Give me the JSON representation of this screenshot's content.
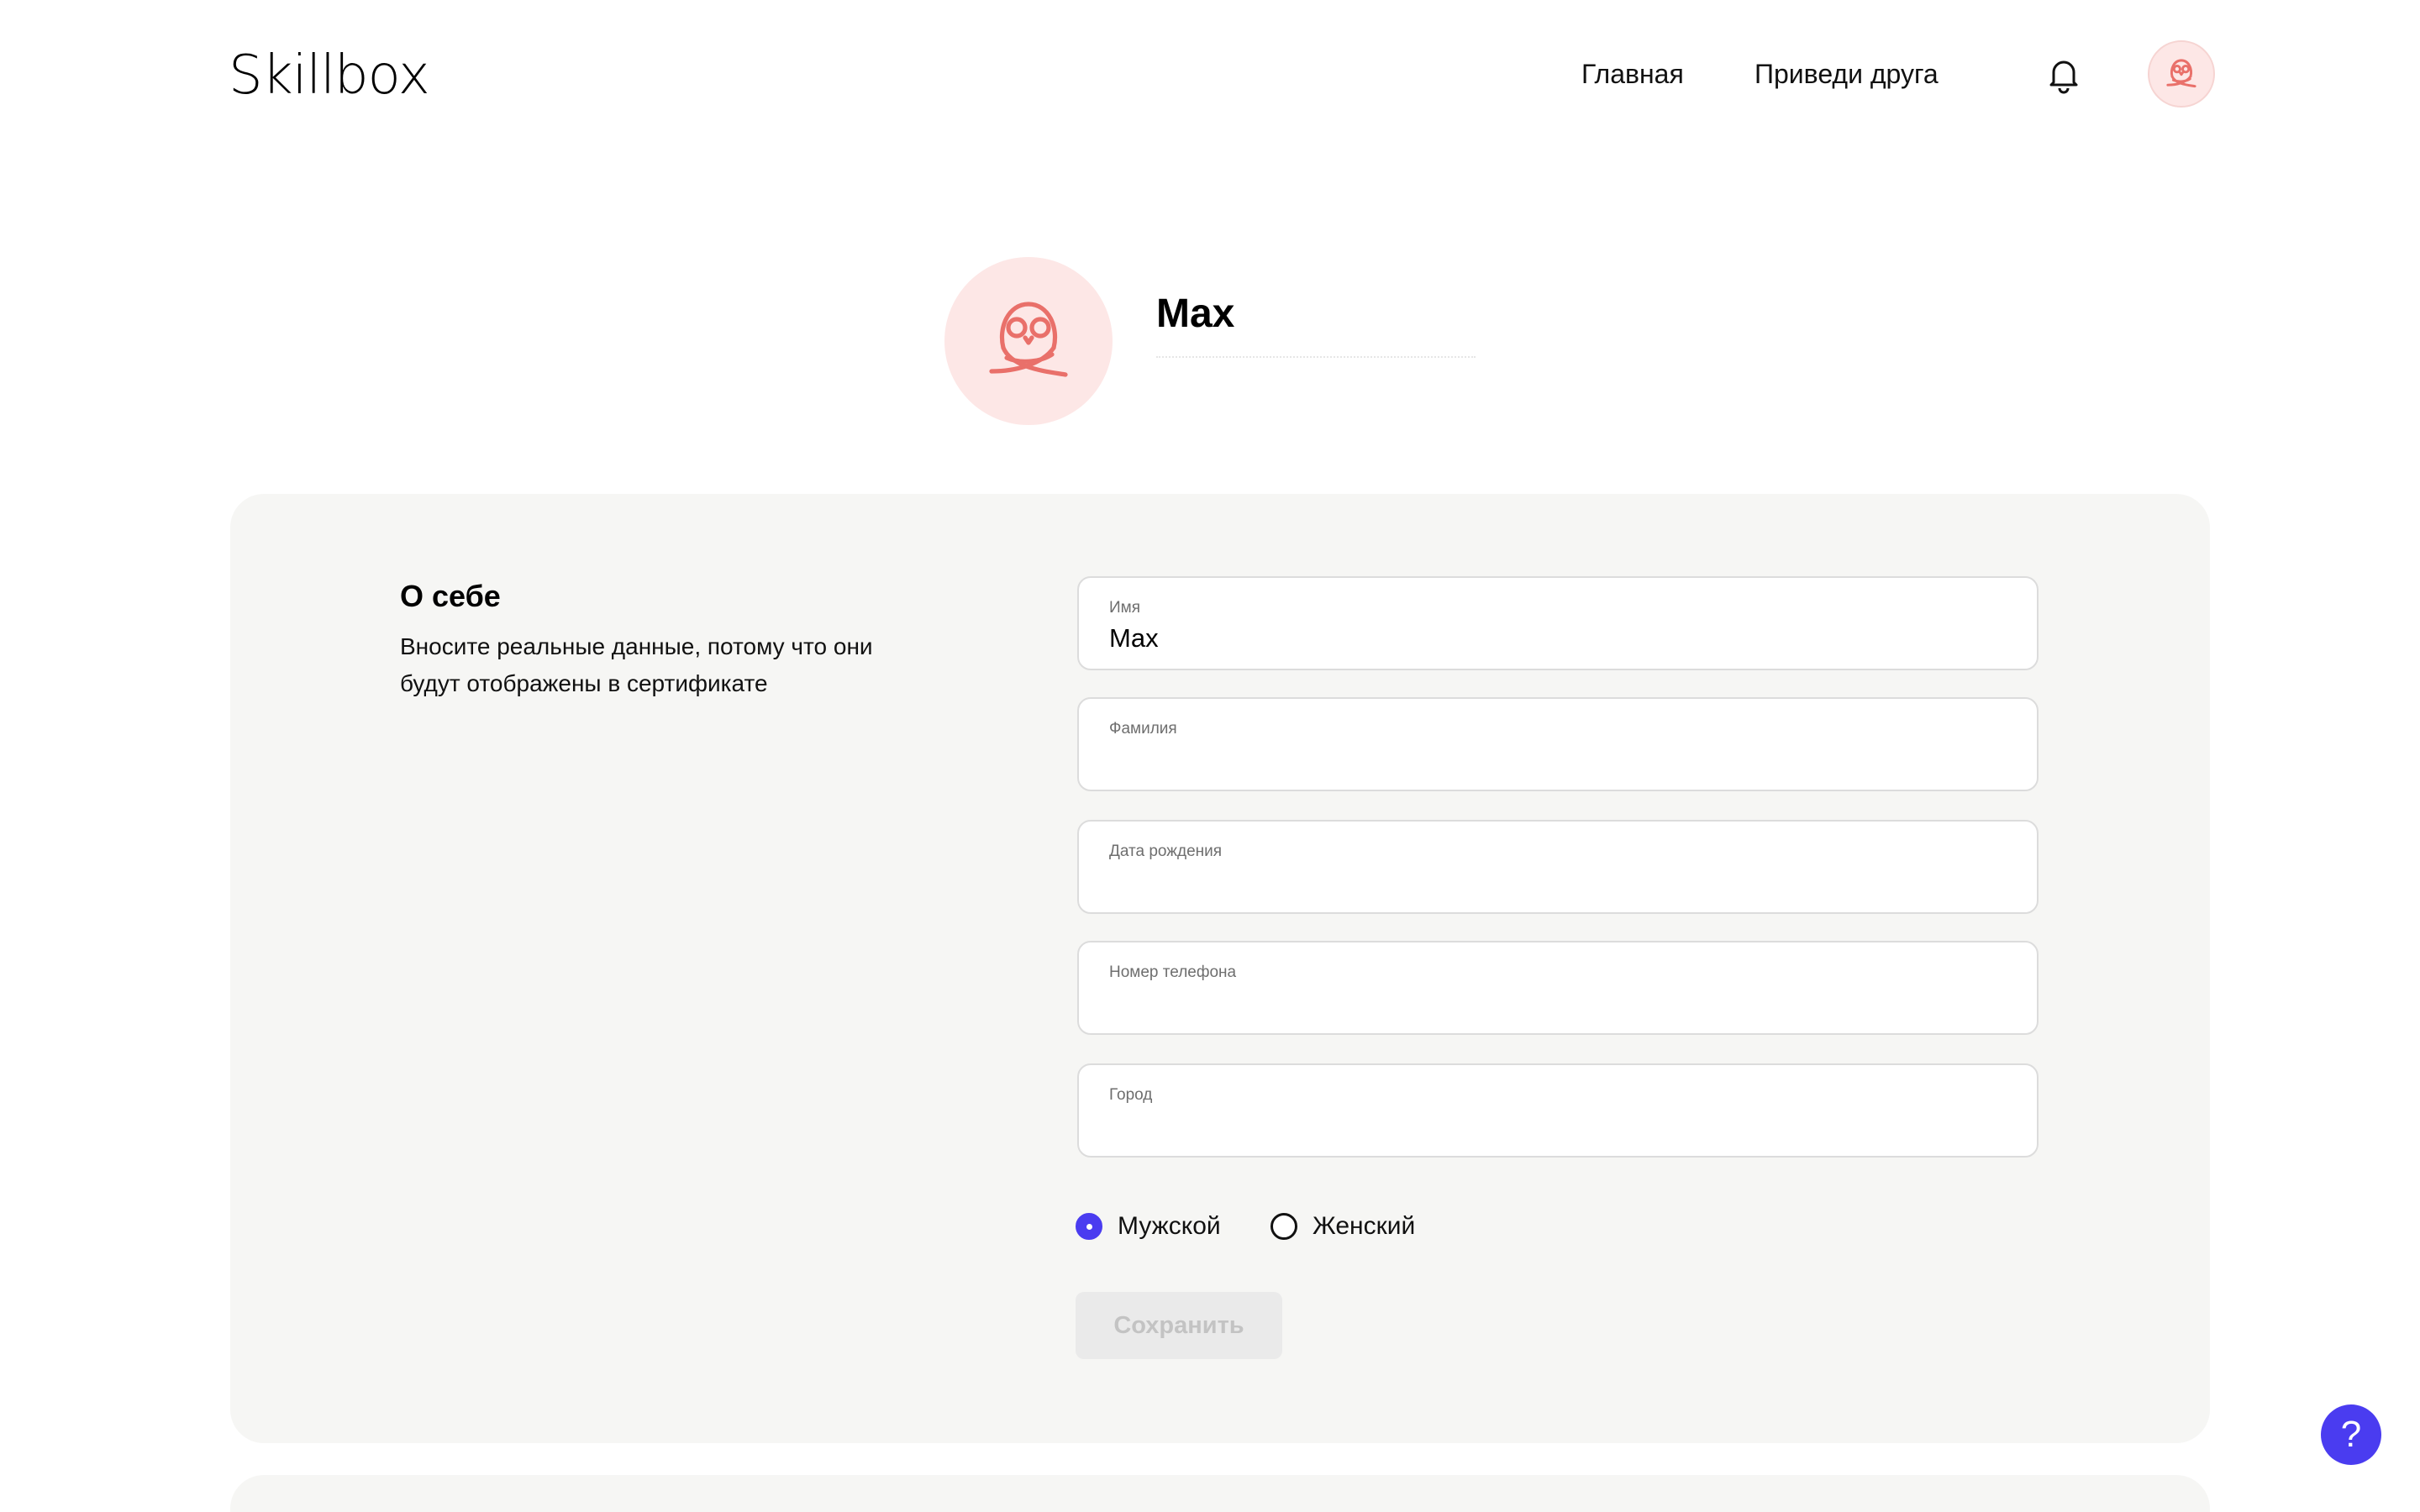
{
  "header": {
    "logo": "Skillbox",
    "nav": {
      "home": "Главная",
      "refer_friend": "Приведи друга"
    },
    "icons": {
      "bell": "bell-icon",
      "avatar": "owl-avatar-icon"
    }
  },
  "profile": {
    "name": "Max"
  },
  "about": {
    "title": "О себе",
    "description": "Вносите реальные данные, потому что они будут отображены в сертификате",
    "fields": [
      {
        "label": "Имя",
        "value": "Max"
      },
      {
        "label": "Фамилия",
        "value": ""
      },
      {
        "label": "Дата рождения",
        "value": ""
      },
      {
        "label": "Номер телефона",
        "value": ""
      },
      {
        "label": "Город",
        "value": ""
      }
    ],
    "gender": {
      "options": [
        "Мужской",
        "Женский"
      ],
      "selected": "Мужской"
    },
    "save_label": "Сохранить"
  },
  "help": {
    "label": "?"
  },
  "colors": {
    "accent": "#4a3cf0",
    "avatar_bg": "#fde7e6",
    "avatar_icon": "#e9706a",
    "card_bg": "#f6f6f4"
  }
}
